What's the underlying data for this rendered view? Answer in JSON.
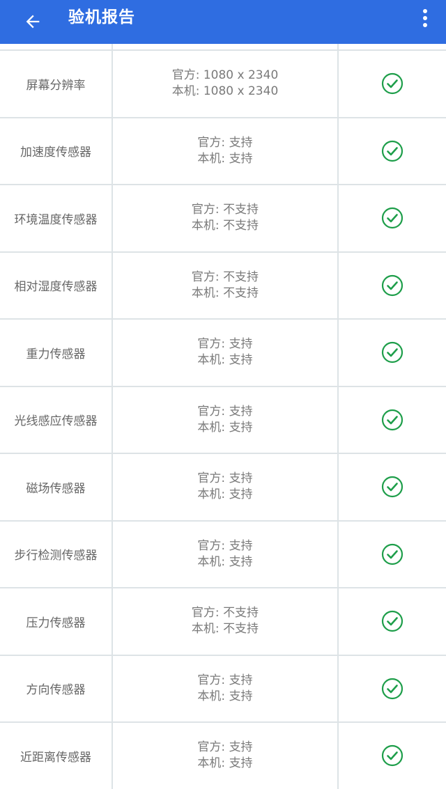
{
  "appbar": {
    "title": "验机报告",
    "back_icon": "arrow-left-icon",
    "more_icon": "more-vert-icon",
    "color": "#2f6de1"
  },
  "labels": {
    "official": "官方",
    "device": "本机",
    "separator": ": "
  },
  "status_color": "#1e9e4a",
  "rows": [
    {
      "name": "屏幕分辨率",
      "official": "1080 x 2340",
      "device": "1080 x 2340",
      "status": "check-circle-icon"
    },
    {
      "name": "加速度传感器",
      "official": "支持",
      "device": "支持",
      "status": "check-circle-icon"
    },
    {
      "name": "环境温度传感器",
      "official": "不支持",
      "device": "不支持",
      "status": "check-circle-icon"
    },
    {
      "name": "相对湿度传感器",
      "official": "不支持",
      "device": "不支持",
      "status": "check-circle-icon"
    },
    {
      "name": "重力传感器",
      "official": "支持",
      "device": "支持",
      "status": "check-circle-icon"
    },
    {
      "name": "光线感应传感器",
      "official": "支持",
      "device": "支持",
      "status": "check-circle-icon"
    },
    {
      "name": "磁场传感器",
      "official": "支持",
      "device": "支持",
      "status": "check-circle-icon"
    },
    {
      "name": "步行检测传感器",
      "official": "支持",
      "device": "支持",
      "status": "check-circle-icon"
    },
    {
      "name": "压力传感器",
      "official": "不支持",
      "device": "不支持",
      "status": "check-circle-icon"
    },
    {
      "name": "方向传感器",
      "official": "支持",
      "device": "支持",
      "status": "check-circle-icon"
    },
    {
      "name": "近距离传感器",
      "official": "支持",
      "device": "支持",
      "status": "check-circle-icon"
    }
  ]
}
